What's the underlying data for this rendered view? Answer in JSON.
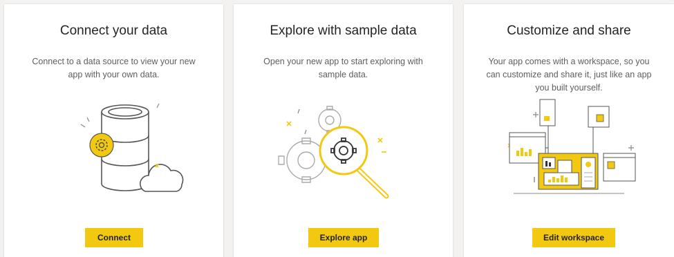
{
  "cards": [
    {
      "title": "Connect your data",
      "description": "Connect to a data source to view your new app with your own data.",
      "button": "Connect",
      "illustration": "database-cloud-icon"
    },
    {
      "title": "Explore with sample data",
      "description": "Open your new app to start exploring with sample data.",
      "button": "Explore app",
      "illustration": "gear-magnifier-icon"
    },
    {
      "title": "Customize and share",
      "description": "Your app comes with a workspace, so you can customize and share it, just like an app you built yourself.",
      "button": "Edit workspace",
      "illustration": "workspace-dashboard-icon"
    }
  ],
  "colors": {
    "accent": "#f2c811",
    "title": "#252423",
    "text": "#605e5c",
    "outline": "#555555"
  }
}
